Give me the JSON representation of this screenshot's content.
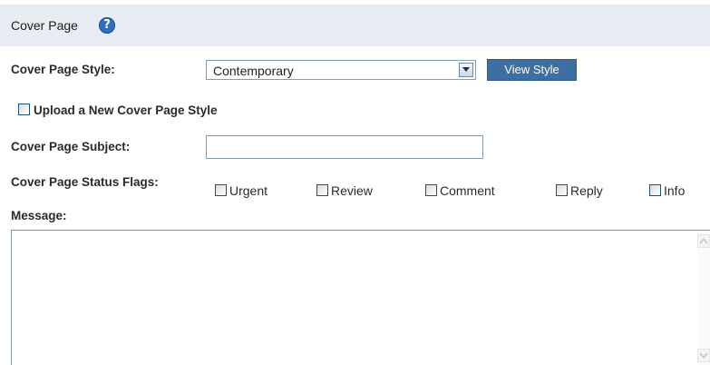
{
  "header": {
    "title": "Cover Page",
    "help_glyph": "?"
  },
  "style_row": {
    "label": "Cover Page Style:",
    "selected": "Contemporary",
    "button_label": "View Style"
  },
  "upload": {
    "label": "Upload a New Cover Page Style",
    "checked": false
  },
  "subject": {
    "label": "Cover Page Subject:",
    "value": ""
  },
  "flags": {
    "label": "Cover Page Status Flags:",
    "items": [
      {
        "label": "Urgent",
        "checked": false
      },
      {
        "label": "Review",
        "checked": false
      },
      {
        "label": "Comment",
        "checked": false
      },
      {
        "label": "Reply",
        "checked": false
      },
      {
        "label": "Info",
        "checked": false
      }
    ]
  },
  "message": {
    "label": "Message:",
    "value": ""
  },
  "colors": {
    "header_bg": "#e8edf3",
    "button_bg": "#3e6fa3",
    "help_icon": "#2f6fc0",
    "field_border": "#7f9db9"
  }
}
